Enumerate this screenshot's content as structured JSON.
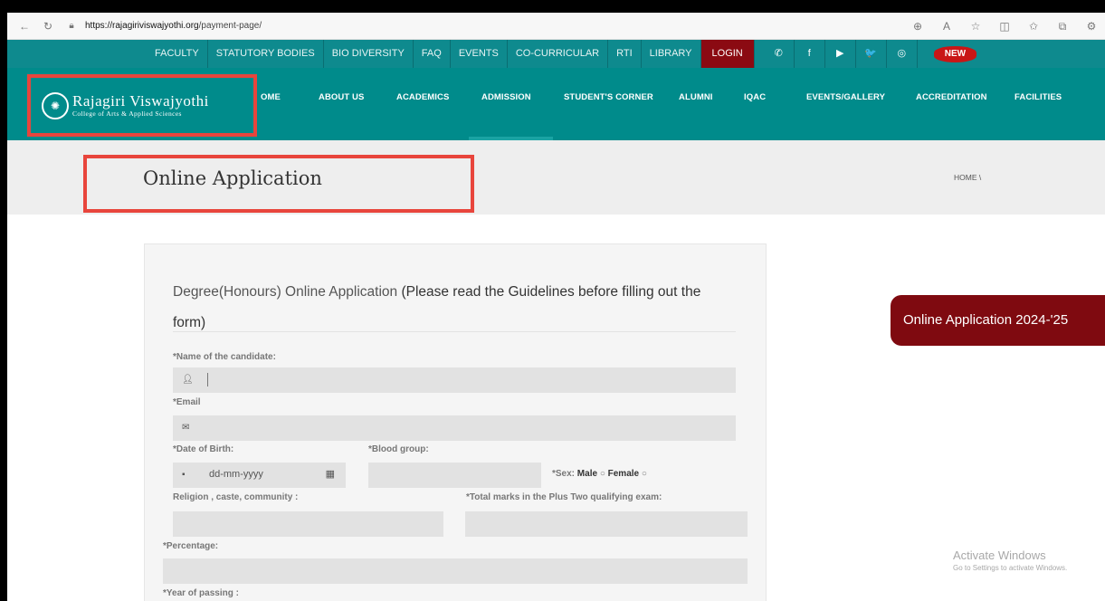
{
  "browser": {
    "url_host": "https://rajagiriviswajyothi.org",
    "url_path": "/payment-page/",
    "icons": [
      "back-icon",
      "reload-icon",
      "lock-icon",
      "zoom-icon",
      "read-aloud-icon",
      "favorite-icon",
      "split-screen-icon",
      "favorites-icon",
      "collections-icon",
      "extensions-icon"
    ]
  },
  "top_strip": {
    "items": [
      "FACULTY",
      "STATUTORY BODIES",
      "BIO DIVERSITY",
      "FAQ",
      "EVENTS",
      "CO-CURRICULAR",
      "RTI",
      "LIBRARY"
    ],
    "login": "LOGIN",
    "social_icons": [
      "phone-icon",
      "facebook-icon",
      "youtube-icon",
      "twitter-icon",
      "instagram-icon"
    ],
    "social_glyphs": [
      "✆",
      "f",
      "▶",
      "🐦",
      "◎"
    ],
    "new_badge": "NEW"
  },
  "logo": {
    "name": "Rajagiri Viswajyothi",
    "subtitle": "College of Arts & Applied Sciences"
  },
  "nav": {
    "items": [
      "OME",
      "ABOUT US",
      "ACADEMICS",
      "ADMISSION",
      "STUDENT'S CORNER",
      "ALUMNI",
      "IQAC",
      "EVENTS/GALLERY",
      "ACCREDITATION",
      "FACILITIES"
    ]
  },
  "title_band": {
    "title": "Online Application",
    "breadcrumb": "HOME \\"
  },
  "form": {
    "heading_part1": "Degree(Honours) Online Application",
    "heading_part2": " (Please read the Guidelines before filling out the form)",
    "labels": {
      "name": "*Name of the candidate:",
      "email": "*Email",
      "dob": "*Date of Birth:",
      "blood": "*Blood group:",
      "religion": "Religion , caste, community :",
      "marks": "*Total marks in the Plus Two qualifying exam:",
      "percentage": "*Percentage:",
      "year": "*Year of passing :"
    },
    "dob_placeholder": "dd-mm-yyyy",
    "sex_label": "*Sex:",
    "sex_male": "Male",
    "sex_female": "Female"
  },
  "sidebar": {
    "online_app_button": "Online Application 2024-'25"
  },
  "watermark": {
    "line1": "Activate Windows",
    "line2": "Go to Settings to activate Windows."
  },
  "colors": {
    "teal": "#008b8b",
    "login_red": "#8b0a12",
    "highlight_box": "#e8453c",
    "online_btn": "#7f0a10"
  }
}
